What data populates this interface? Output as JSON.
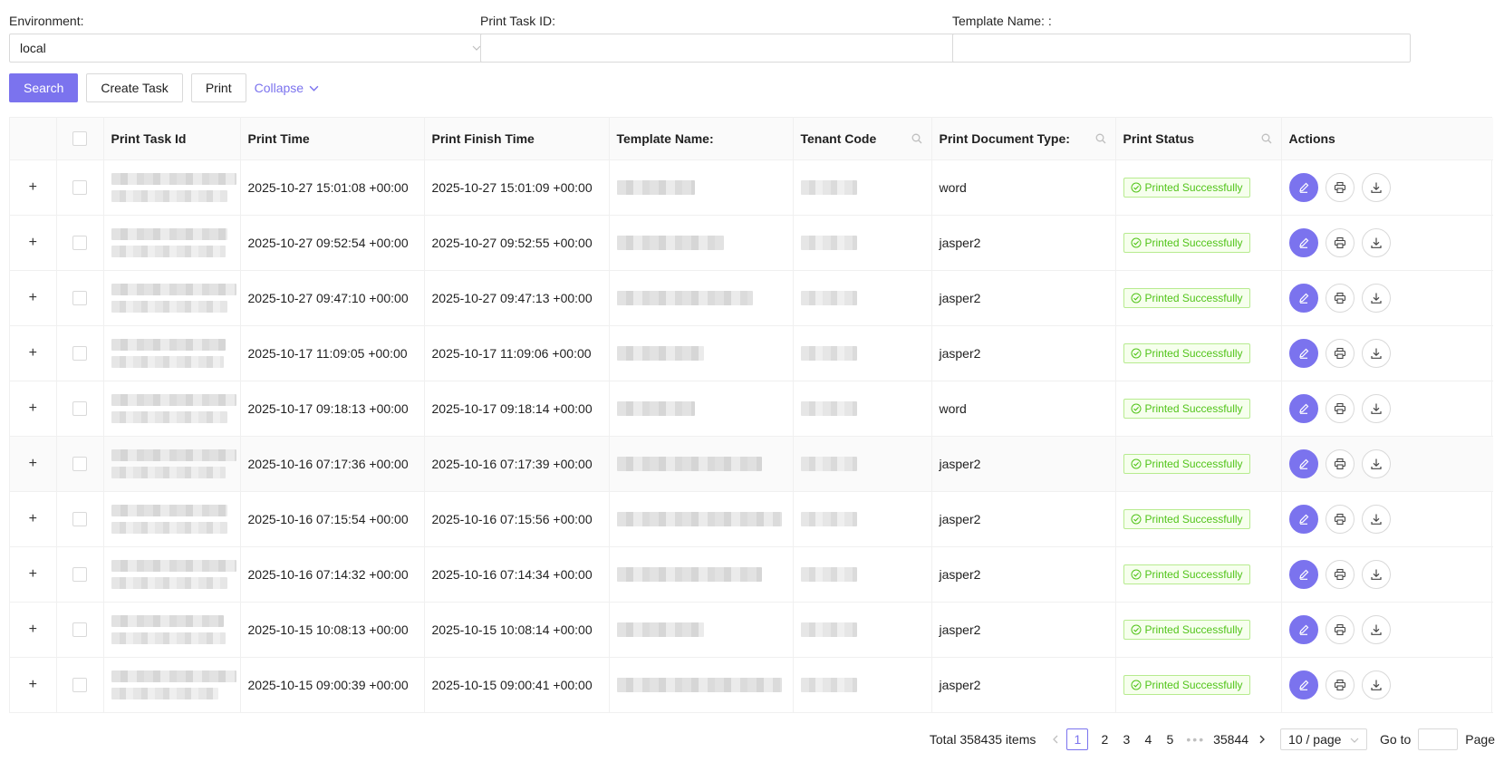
{
  "filters": {
    "environment": {
      "label": "Environment:",
      "value": "local"
    },
    "task_id": {
      "label": "Print Task ID:",
      "value": ""
    },
    "template_name": {
      "label": "Template Name: :",
      "value": ""
    }
  },
  "toolbar": {
    "search": "Search",
    "create_task": "Create Task",
    "print": "Print",
    "collapse": "Collapse"
  },
  "columns": {
    "task_id": "Print Task Id",
    "print_time": "Print Time",
    "finish_time": "Print Finish Time",
    "template": "Template Name:",
    "tenant": "Tenant Code",
    "doc_type": "Print Document Type:",
    "status": "Print Status",
    "actions": "Actions"
  },
  "rows": [
    {
      "print_time": "2025-10-27 15:01:08 +00:00",
      "finish_time": "2025-10-27 15:01:09 +00:00",
      "doc_type": "word",
      "status": "Printed Successfully"
    },
    {
      "print_time": "2025-10-27 09:52:54 +00:00",
      "finish_time": "2025-10-27 09:52:55 +00:00",
      "doc_type": "jasper2",
      "status": "Printed Successfully"
    },
    {
      "print_time": "2025-10-27 09:47:10 +00:00",
      "finish_time": "2025-10-27 09:47:13 +00:00",
      "doc_type": "jasper2",
      "status": "Printed Successfully"
    },
    {
      "print_time": "2025-10-17 11:09:05 +00:00",
      "finish_time": "2025-10-17 11:09:06 +00:00",
      "doc_type": "jasper2",
      "status": "Printed Successfully"
    },
    {
      "print_time": "2025-10-17 09:18:13 +00:00",
      "finish_time": "2025-10-17 09:18:14 +00:00",
      "doc_type": "word",
      "status": "Printed Successfully"
    },
    {
      "print_time": "2025-10-16 07:17:36 +00:00",
      "finish_time": "2025-10-16 07:17:39 +00:00",
      "doc_type": "jasper2",
      "status": "Printed Successfully"
    },
    {
      "print_time": "2025-10-16 07:15:54 +00:00",
      "finish_time": "2025-10-16 07:15:56 +00:00",
      "doc_type": "jasper2",
      "status": "Printed Successfully"
    },
    {
      "print_time": "2025-10-16 07:14:32 +00:00",
      "finish_time": "2025-10-16 07:14:34 +00:00",
      "doc_type": "jasper2",
      "status": "Printed Successfully"
    },
    {
      "print_time": "2025-10-15 10:08:13 +00:00",
      "finish_time": "2025-10-15 10:08:14 +00:00",
      "doc_type": "jasper2",
      "status": "Printed Successfully"
    },
    {
      "print_time": "2025-10-15 09:00:39 +00:00",
      "finish_time": "2025-10-15 09:00:41 +00:00",
      "doc_type": "jasper2",
      "status": "Printed Successfully"
    }
  ],
  "pagination": {
    "total": "Total 358435 items",
    "pages": [
      "1",
      "2",
      "3",
      "4",
      "5"
    ],
    "ellipsis": "•••",
    "last_page": "35844",
    "page_size": "10 / page",
    "goto_label": "Go to",
    "page_label": "Page"
  },
  "colors": {
    "primary": "#7b73ee",
    "success": "#52c41a"
  }
}
